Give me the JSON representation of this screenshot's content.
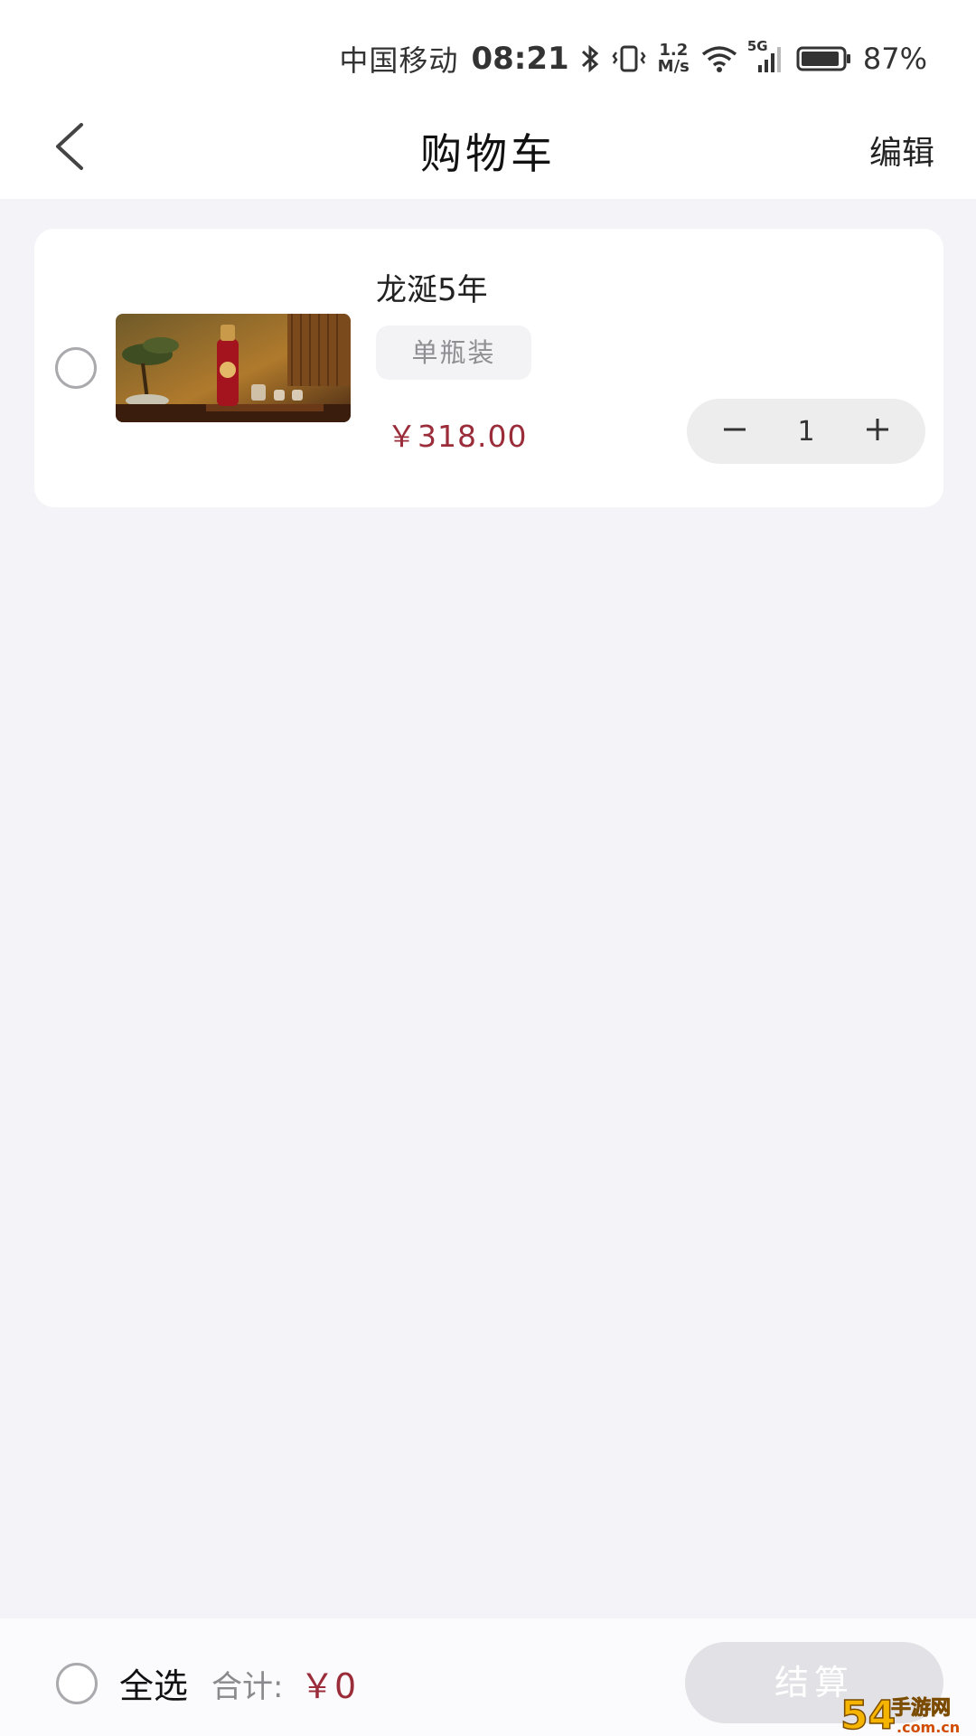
{
  "status_bar": {
    "carrier": "中国移动",
    "time": "08:21",
    "speed_value": "1.2",
    "speed_unit": "M/s",
    "network": "5G",
    "battery": "87%",
    "icons": [
      "bluetooth-icon",
      "vibrate-icon",
      "wifi-icon",
      "signal-icon",
      "battery-icon"
    ]
  },
  "header": {
    "back_icon": "chevron-left-icon",
    "title": "购物车",
    "edit_label": "编辑"
  },
  "cart": {
    "items": [
      {
        "name": "龙涎5年",
        "variant": "单瓶装",
        "price": "￥318.00",
        "quantity": "1",
        "selected": false
      }
    ]
  },
  "footer": {
    "select_all_label": "全选",
    "total_label": "合计:",
    "total_value": "￥0",
    "checkout_label": "结算"
  },
  "watermark": {
    "text": "54手游网",
    "subtext": ".com.cn"
  },
  "colors": {
    "accent": "#9b2c3a",
    "background": "#f4f3f7",
    "card": "#ffffff",
    "disabled_button": "#e2e2e6"
  }
}
